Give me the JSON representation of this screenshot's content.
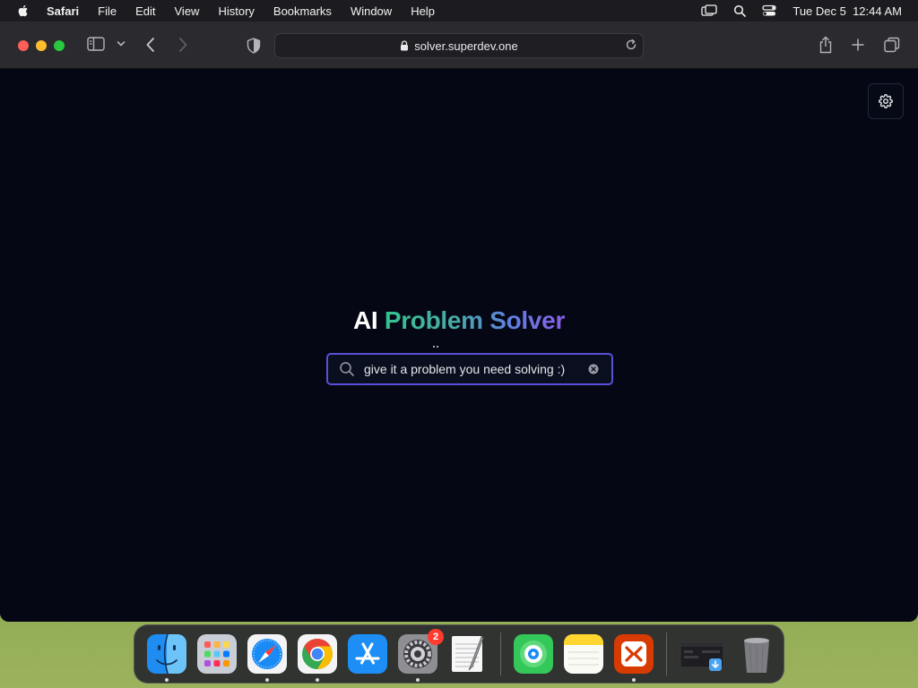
{
  "menubar": {
    "app_name": "Safari",
    "items": [
      "File",
      "Edit",
      "View",
      "History",
      "Bookmarks",
      "Window",
      "Help"
    ],
    "datetime": "Tue Dec 5  12:44 AM"
  },
  "browser": {
    "url": "solver.superdev.one"
  },
  "page": {
    "title_prefix": "AI",
    "title_highlight": "Problem Solver",
    "search_value": "give it a problem you need solving :)",
    "accent_color": "#5a4fd8"
  },
  "dock": {
    "apps": [
      {
        "name": "Finder",
        "running": true
      },
      {
        "name": "Launchpad",
        "running": false
      },
      {
        "name": "Safari",
        "running": true
      },
      {
        "name": "Google Chrome",
        "running": true
      },
      {
        "name": "App Store",
        "running": false
      },
      {
        "name": "System Settings",
        "running": true,
        "badge": "2"
      },
      {
        "name": "TextEdit",
        "running": false
      },
      {
        "name": "Find My",
        "running": false
      },
      {
        "name": "Notes",
        "running": false
      },
      {
        "name": "Remote Desktop",
        "running": true
      }
    ]
  }
}
